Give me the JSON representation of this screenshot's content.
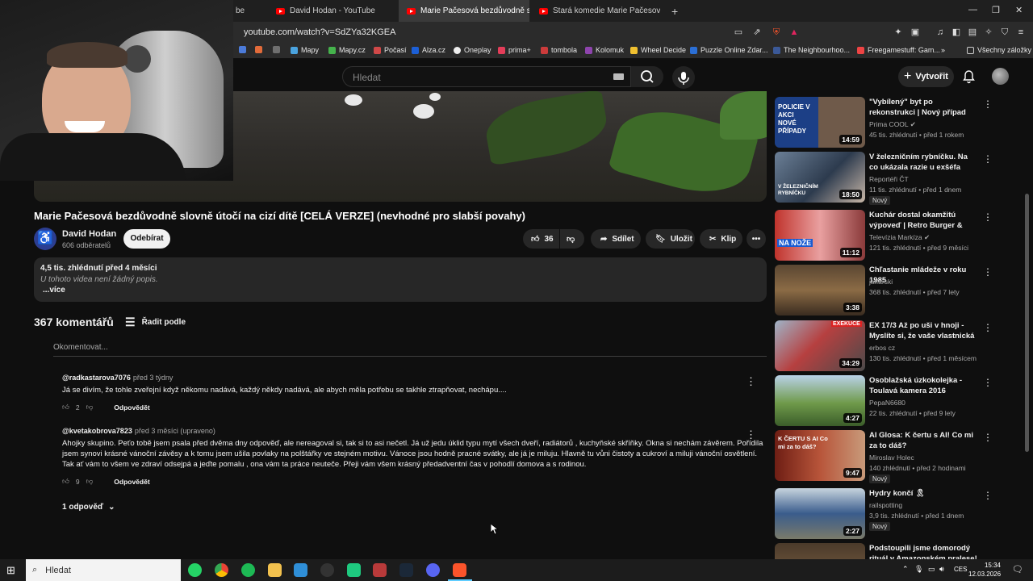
{
  "browser": {
    "tabs": [
      {
        "label": "David Hodan - YouTube"
      },
      {
        "label": "Marie Pačesová bezdůvodně slo"
      },
      {
        "label": "Stará komedie Marie Pačesová aneb"
      }
    ],
    "tab_prefix": "be",
    "new_tab": "+",
    "url": "youtube.com/watch?v=SdZYa32KGEA",
    "bookmarks": [
      "Mapy",
      "Mapy.cz",
      "Počasí",
      "Alza.cz",
      "Oneplay",
      "prima+",
      "tombola",
      "Kolomuk",
      "Wheel Decide",
      "Puzzle Online Zdar...",
      "The Neighbourhoo...",
      "Freegamestuff: Gam..."
    ],
    "bookmarks_more": "»",
    "all_bookmarks": "Všechny záložky"
  },
  "header": {
    "search_placeholder": "Hledat",
    "create_label": "Vytvořit"
  },
  "video": {
    "title": "Marie Pačesová bezdůvodně slovně útočí na cizí dítě [CELÁ VERZE] (nevhodné pro slabší povahy)",
    "channel": "David Hodan",
    "subscribers": "606 odběratelů",
    "subscribe_label": "Odebírat",
    "likes": "36",
    "share_label": "Sdílet",
    "save_label": "Uložit",
    "clip_label": "Klip",
    "description": {
      "stats": "4,5 tis. zhlédnutí  před 4 měsíci",
      "text": "U tohoto videa není žádný popis.",
      "more": "...více"
    }
  },
  "comments": {
    "count_label": "367 komentářů",
    "sort_label": "Řadit podle",
    "add_placeholder": "Okomentovat...",
    "items": [
      {
        "author": "@radkastarova7076",
        "time": "před 3 týdny",
        "text": "Já se divím, že tohle zveřejní když někomu nadává, každý někdy nadává, ale abych měla potřebu se takhle ztrapňovat, nechápu....",
        "likes": "2",
        "reply": "Odpovědět"
      },
      {
        "author": "@kvetakobrova7823",
        "time": "před 3 měsíci (upraveno)",
        "text": "Ahojky skupino. Peťo tobě jsem psala před dvěma dny odpověď, ale nereagoval si, tak si to asi nečetl. Já už jedu úklid typu mytí všech dveří, radiátorů , kuchyňské skříňky. Okna si nechám závěrem. Pořídila jsem synovi krásné vánoční závěsy a k tomu jsem ušila povlaky na polštářky ve stejném motivu. Vánoce jsou hodně pracné svátky, ale já je miluju. Hlavně tu vůni čistoty a cukroví a miluji vánoční osvětlení. Tak ať vám to všem ve zdraví odsejpá a jeďte pomalu , ona vám ta práce neuteče. Přeji vám všem krásný předadventní čas v pohodlí domova a s rodinou.",
        "likes": "9",
        "reply": "Odpovědět"
      }
    ],
    "replies_label": "1 odpověď"
  },
  "sidebar": [
    {
      "title": "\"Vybílený\" byt po rekonstrukci | Nový případ Policie v akci",
      "channel": "Prima COOL",
      "meta": "45 tis. zhlédnutí • před 1 rokem",
      "duration": "14:59",
      "badge": "",
      "thumb_text": "POLICIE V AKCI NOVÉ PŘÍPADY"
    },
    {
      "title": "V železničním rybníčku. Na co ukázala razie u exšéfa železni...",
      "channel": "Reportéři ČT",
      "meta": "11 tis. zhlédnutí • před 1 dnem",
      "duration": "18:50",
      "badge": "Nový",
      "thumb_text": "V ŽELEZNIČNÍM RYBNÍČKU"
    },
    {
      "title": "Kuchár dostal okamžitú výpoveď | Retro Burger & Dinn...",
      "channel": "Televízia Markíza",
      "meta": "121 tis. zhlédnutí • před 9 měsíci",
      "duration": "11:12",
      "badge": "",
      "thumb_text": "NA NOŽE"
    },
    {
      "title": "Chľastanie mládeže v roku 1985",
      "channel": "jaffarski",
      "meta": "368 tis. zhlédnutí • před 7 lety",
      "duration": "3:38",
      "badge": "",
      "thumb_text": ""
    },
    {
      "title": "EX 17/3 Až po uši v hnoji - Myslíte si, že vaše vlastnická ...",
      "channel": "erbos cz",
      "meta": "130 tis. zhlédnutí • před 1 měsícem",
      "duration": "34:29",
      "badge": "",
      "thumb_text": "EXEKUCE"
    },
    {
      "title": "Osoblažská úzkokolejka - Toulavá kamera 2016",
      "channel": "PepaN6680",
      "meta": "22 tis. zhlédnutí • před 9 lety",
      "duration": "4:27",
      "badge": "",
      "thumb_text": ""
    },
    {
      "title": "AI Glosa: K čertu s AI! Co mi za to dáš?",
      "channel": "Miroslav Holec",
      "meta": "140 zhlédnutí • před 2 hodinami",
      "duration": "9:47",
      "badge": "Nový",
      "thumb_text": "K ČERTU S AI Co mi za to dáš?"
    },
    {
      "title": "Hydry končí 🎗",
      "channel": "railspotting",
      "meta": "3,9 tis. zhlédnutí • před 1 dnem",
      "duration": "2:27",
      "badge": "Nový",
      "thumb_text": ""
    },
    {
      "title": "Podstoupili jsme domorodý rituál v Amazonském pralese!",
      "channel": "",
      "meta": "",
      "duration": "",
      "badge": "",
      "thumb_text": ""
    }
  ],
  "taskbar": {
    "search": "Hledat",
    "lang": "CES",
    "time": "15:34",
    "date": "12.03.2026"
  }
}
